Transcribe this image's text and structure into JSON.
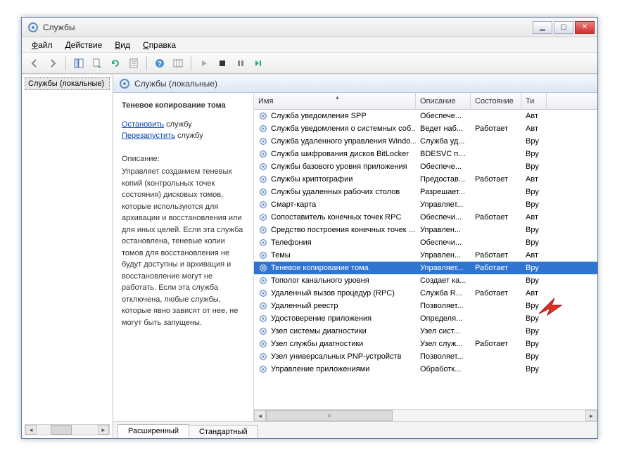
{
  "window": {
    "title": "Службы"
  },
  "menu": {
    "file": "Файл",
    "action": "Действие",
    "view": "Вид",
    "help": "Справка"
  },
  "left": {
    "node": "Службы (локальные)"
  },
  "right": {
    "header": "Службы (локальные)"
  },
  "detail": {
    "name": "Теневое копирование тома",
    "stop_link": "Остановить",
    "stop_suffix": " службу",
    "restart_link": "Перезапустить",
    "restart_suffix": " службу",
    "desc_heading": "Описание:",
    "desc": "Управляет созданием теневых копий (контрольных точек состояния) дисковых томов, которые используются для архивации и восстановления или для иных целей. Если эта служба остановлена, теневые копии томов для восстановления не будут доступны и архивация и восстановление могут не работать. Если эта служба отключена, любые службы, которые явно зависят от нее, не могут быть запущены."
  },
  "columns": {
    "name": "Имя",
    "desc": "Описание",
    "state": "Состояние",
    "type": "Ти"
  },
  "tabs": {
    "extended": "Расширенный",
    "standard": "Стандартный"
  },
  "services": [
    {
      "name": "Служба уведомления SPP",
      "desc": "Обеспече...",
      "state": "",
      "type": "Авт"
    },
    {
      "name": "Служба уведомления о системных соб...",
      "desc": "Ведет наб...",
      "state": "Работает",
      "type": "Авт"
    },
    {
      "name": "Служба удаленного управления Windo...",
      "desc": "Служба уд...",
      "state": "",
      "type": "Вру"
    },
    {
      "name": "Служба шифрования дисков BitLocker",
      "desc": "BDESVC пр...",
      "state": "",
      "type": "Вру"
    },
    {
      "name": "Службы базового уровня приложения",
      "desc": "Обеспече...",
      "state": "",
      "type": "Вру"
    },
    {
      "name": "Службы криптографии",
      "desc": "Предостав...",
      "state": "Работает",
      "type": "Авт"
    },
    {
      "name": "Службы удаленных рабочих столов",
      "desc": "Разрешает...",
      "state": "",
      "type": "Вру"
    },
    {
      "name": "Смарт-карта",
      "desc": "Управляет...",
      "state": "",
      "type": "Вру"
    },
    {
      "name": "Сопоставитель конечных точек RPC",
      "desc": "Обеспечи...",
      "state": "Работает",
      "type": "Авт"
    },
    {
      "name": "Средство построения конечных точек ...",
      "desc": "Управлен...",
      "state": "",
      "type": "Вру"
    },
    {
      "name": "Телефония",
      "desc": "Обеспечи...",
      "state": "",
      "type": "Вру"
    },
    {
      "name": "Темы",
      "desc": "Управлен...",
      "state": "Работает",
      "type": "Авт"
    },
    {
      "name": "Теневое копирование тома",
      "desc": "Управляет...",
      "state": "Работает",
      "type": "Вру",
      "selected": true
    },
    {
      "name": "Тополог канального уровня",
      "desc": "Создает ка...",
      "state": "",
      "type": "Вру"
    },
    {
      "name": "Удаленный вызов процедур (RPC)",
      "desc": "Служба R...",
      "state": "Работает",
      "type": "Авт"
    },
    {
      "name": "Удаленный реестр",
      "desc": "Позволяет...",
      "state": "",
      "type": "Вру"
    },
    {
      "name": "Удостоверение приложения",
      "desc": "Определя...",
      "state": "",
      "type": "Вру"
    },
    {
      "name": "Узел системы диагностики",
      "desc": "Узел сист...",
      "state": "",
      "type": "Вру"
    },
    {
      "name": "Узел службы диагностики",
      "desc": "Узел служ...",
      "state": "Работает",
      "type": "Вру"
    },
    {
      "name": "Узел универсальных PNP-устройств",
      "desc": "Позволяет...",
      "state": "",
      "type": "Вру"
    },
    {
      "name": "Управление приложениями",
      "desc": "Обработк...",
      "state": "",
      "type": "Вру"
    }
  ]
}
